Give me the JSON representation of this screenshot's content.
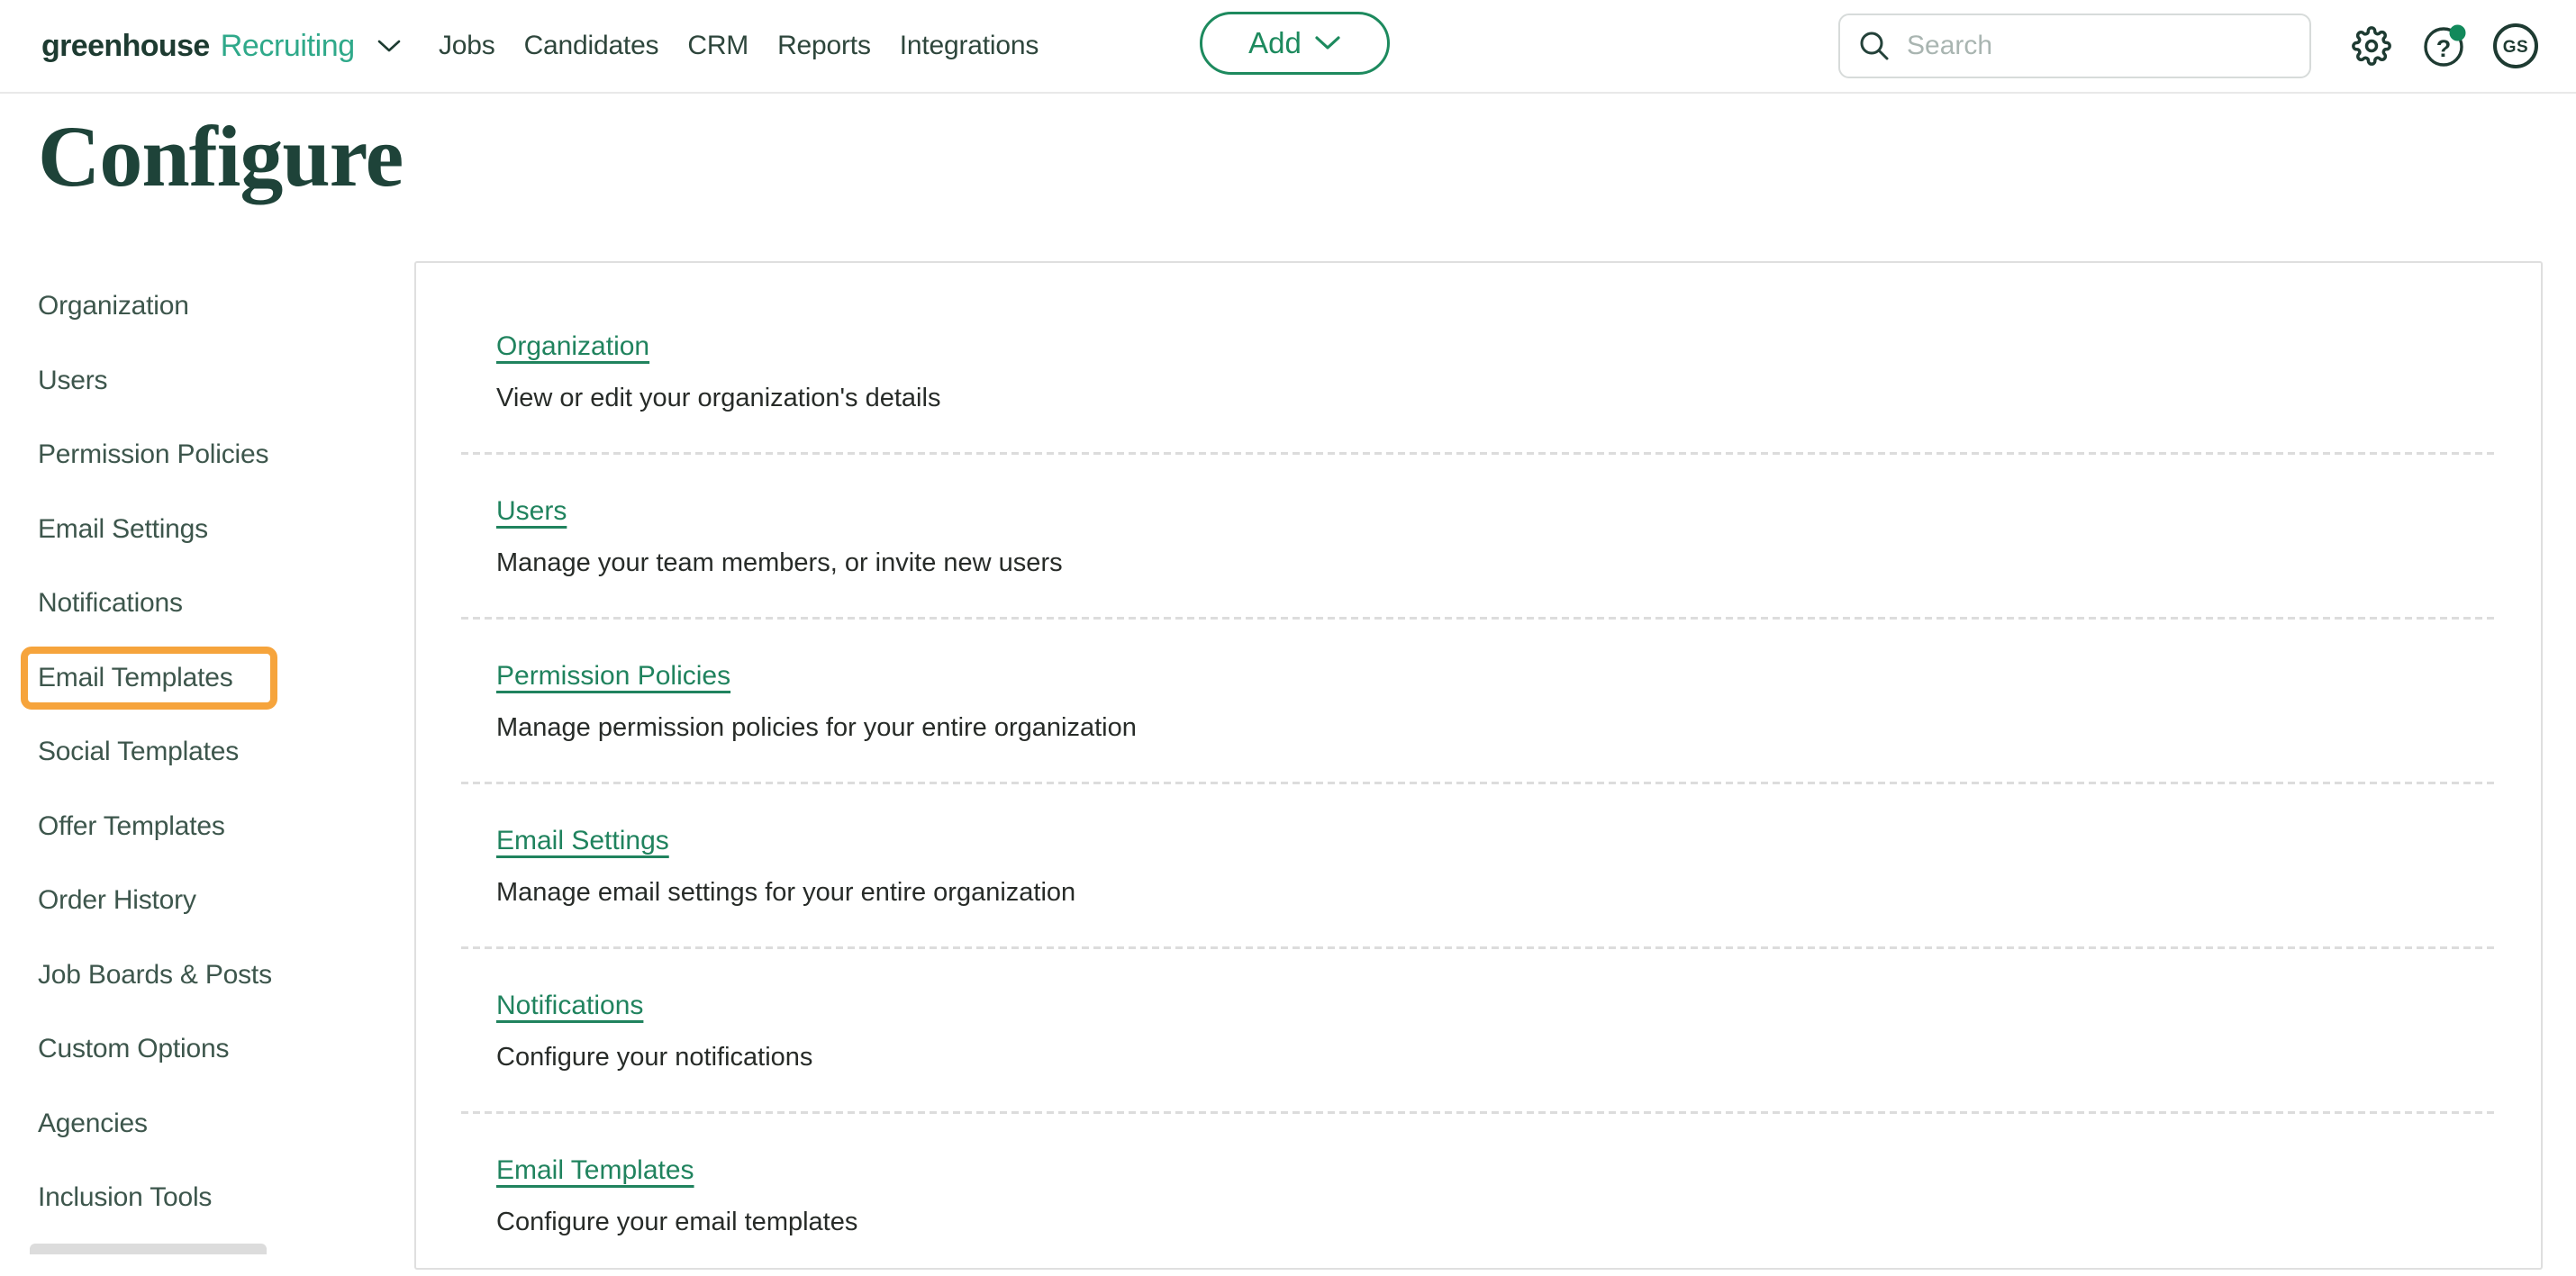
{
  "header": {
    "brand": "greenhouse",
    "product": "Recruiting",
    "nav_items": [
      "Jobs",
      "Candidates",
      "CRM",
      "Reports",
      "Integrations"
    ],
    "add_button_label": "Add",
    "search_placeholder": "Search",
    "help_glyph": "?",
    "avatar_initials": "GS"
  },
  "page_title": "Configure",
  "sidebar": {
    "items": [
      "Organization",
      "Users",
      "Permission Policies",
      "Email Settings",
      "Notifications",
      "Email Templates",
      "Social Templates",
      "Offer Templates",
      "Order History",
      "Job Boards & Posts",
      "Custom Options",
      "Agencies",
      "Inclusion Tools"
    ],
    "highlighted_item": "Email Templates"
  },
  "content": {
    "sections": [
      {
        "link": "Organization",
        "description": "View or edit your organization's details"
      },
      {
        "link": "Users",
        "description": "Manage your team members, or invite new users"
      },
      {
        "link": "Permission Policies",
        "description": "Manage permission policies for your entire organization"
      },
      {
        "link": "Email Settings",
        "description": "Manage email settings for your entire organization"
      },
      {
        "link": "Notifications",
        "description": "Configure your notifications"
      },
      {
        "link": "Email Templates",
        "description": "Configure your email templates"
      }
    ]
  },
  "colors": {
    "brand_dark_green": "#1d3b31",
    "product_green": "#2fa98a",
    "nav_text": "#2e463c",
    "sidebar_text": "#3d564c",
    "link_green": "#20835e",
    "button_green": "#1d8a5e",
    "highlight_orange": "#f6a43c",
    "notification_dot_green": "#12895b",
    "panel_border": "#dfdfdf"
  }
}
